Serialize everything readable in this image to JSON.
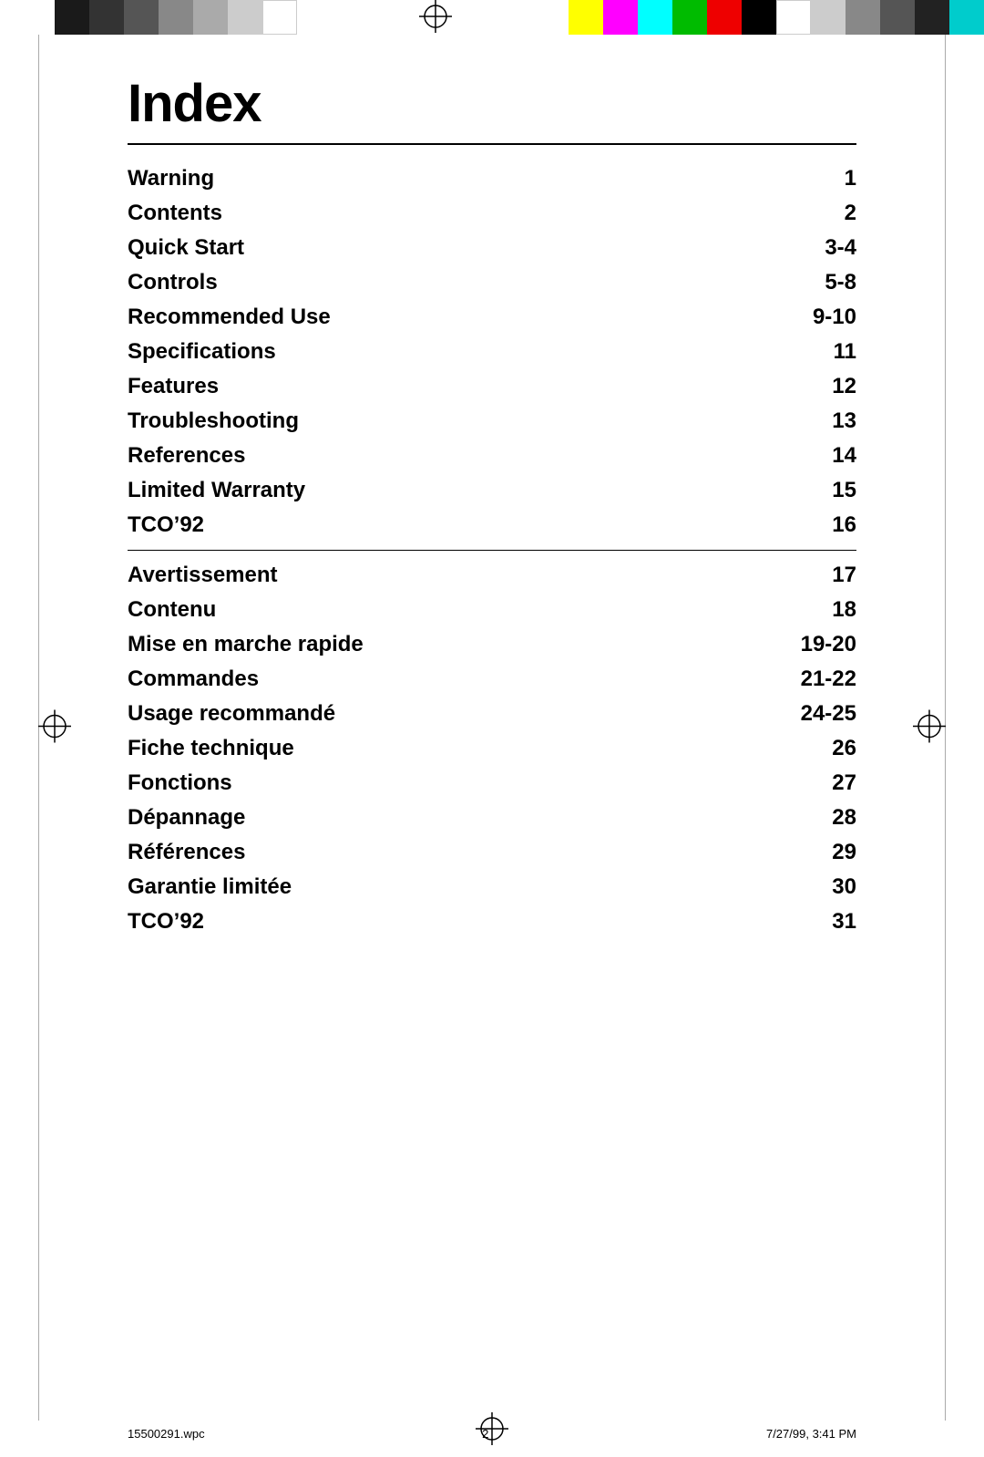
{
  "page": {
    "title": "Index",
    "footer": {
      "left": "15500291.wpc",
      "center": "2",
      "right": "7/27/99, 3:41 PM"
    }
  },
  "top_bar": {
    "left_swatches": [
      {
        "color": "#1a1a1a",
        "name": "black1"
      },
      {
        "color": "#2d2d2d",
        "name": "black2"
      },
      {
        "color": "#555555",
        "name": "gray1"
      },
      {
        "color": "#888888",
        "name": "gray2"
      },
      {
        "color": "#aaaaaa",
        "name": "gray3"
      },
      {
        "color": "#cccccc",
        "name": "gray4"
      },
      {
        "color": "#ffffff",
        "name": "white"
      }
    ],
    "right_swatches": [
      {
        "color": "#ffff00",
        "name": "yellow"
      },
      {
        "color": "#ff00ff",
        "name": "magenta"
      },
      {
        "color": "#00ffff",
        "name": "cyan"
      },
      {
        "color": "#00cc00",
        "name": "green"
      },
      {
        "color": "#ff0000",
        "name": "red"
      },
      {
        "color": "#000000",
        "name": "black-r"
      },
      {
        "color": "#ffffff",
        "name": "white-r"
      },
      {
        "color": "#cccccc",
        "name": "lgray-r"
      },
      {
        "color": "#888888",
        "name": "mgray-r"
      },
      {
        "color": "#555555",
        "name": "dgray-r"
      },
      {
        "color": "#222222",
        "name": "vdgray-r"
      },
      {
        "color": "#00cccc",
        "name": "cyan2"
      }
    ]
  },
  "english_section": {
    "items": [
      {
        "label": "Warning",
        "page": "1"
      },
      {
        "label": "Contents",
        "page": "2"
      },
      {
        "label": "Quick Start",
        "page": "3-4"
      },
      {
        "label": "Controls",
        "page": "5-8"
      },
      {
        "label": "Recommended Use",
        "page": "9-10"
      },
      {
        "label": "Specifications",
        "page": "11"
      },
      {
        "label": "Features",
        "page": "12"
      },
      {
        "label": "Troubleshooting",
        "page": "13"
      },
      {
        "label": "References",
        "page": "14"
      },
      {
        "label": "Limited Warranty",
        "page": "15"
      },
      {
        "label": "TCO’92",
        "page": "16"
      }
    ]
  },
  "french_section": {
    "items": [
      {
        "label": "Avertissement",
        "page": "17"
      },
      {
        "label": "Contenu",
        "page": "18"
      },
      {
        "label": "Mise en marche rapide",
        "page": "19-20"
      },
      {
        "label": "Commandes",
        "page": "21-22"
      },
      {
        "label": "Usage recommandé",
        "page": "24-25"
      },
      {
        "label": "Fiche technique",
        "page": "26"
      },
      {
        "label": "Fonctions",
        "page": "27"
      },
      {
        "label": "Dépannage",
        "page": "28"
      },
      {
        "label": "Références",
        "page": "29"
      },
      {
        "label": "Garantie limitée",
        "page": "30"
      },
      {
        "label": "TCO’92",
        "page": "31"
      }
    ]
  }
}
